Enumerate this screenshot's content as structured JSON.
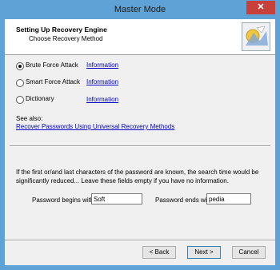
{
  "window": {
    "title": "Master Mode",
    "close_glyph": "✕"
  },
  "header": {
    "title": "Setting Up Recovery Engine",
    "subtitle": "Choose Recovery Method",
    "logo_icon": "wizard-logo-icon"
  },
  "methods": [
    {
      "label": "Brute Force Attack",
      "selected": true,
      "link": "Information"
    },
    {
      "label": "Smart Force Attack",
      "selected": false,
      "link": "Information"
    },
    {
      "label": "Dictionary",
      "selected": false,
      "link": "Information"
    }
  ],
  "see_also": {
    "label": "See also:",
    "link": "Recover Passwords Using Universal Recovery Methods"
  },
  "note": "If the first or/and last characters of the password are known, the search time would be significantly reduced... Leave these fields empty if you have no information.",
  "begins": {
    "label": "Password begins with",
    "value": "Soft"
  },
  "ends": {
    "label": "Password ends with",
    "value": "pedia"
  },
  "buttons": {
    "back": "< Back",
    "next": "Next >",
    "cancel": "Cancel"
  }
}
